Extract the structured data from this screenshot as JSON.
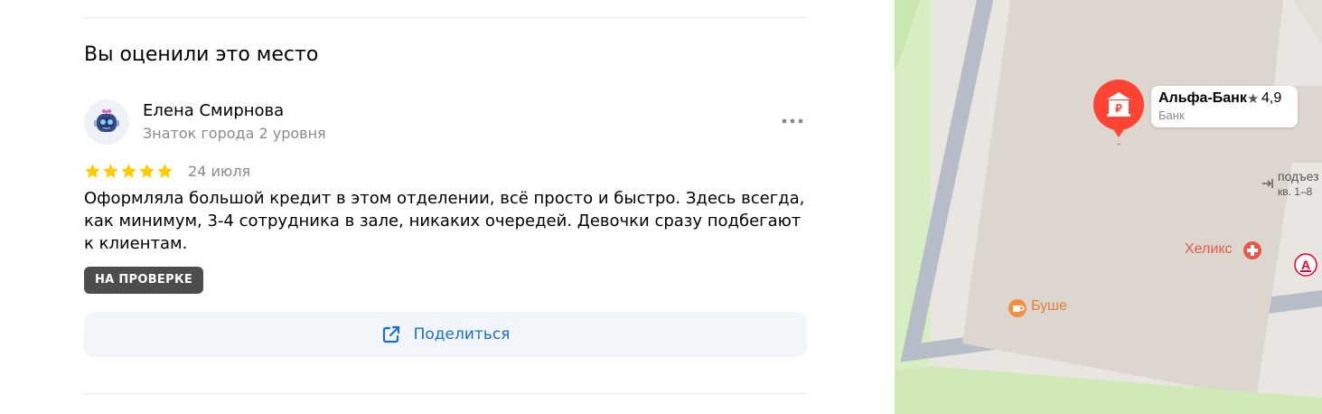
{
  "review": {
    "section_title": "Вы оценили это место",
    "author": {
      "name": "Елена Смирнова",
      "level": "Знаток города 2 уровня"
    },
    "rating": 5,
    "date": "24 июля",
    "text": "Оформляла большой кредит в этом отделении, всё просто и быстро. Здесь всегда, как минимум, 3-4 сотрудника в зале, никаких очередей. Девочки сразу подбегают к клиентам.",
    "status_badge": "НА ПРОВЕРКЕ",
    "share_label": "Поделиться"
  },
  "map": {
    "place": {
      "name": "Альфа-Банк",
      "rating": "4,9",
      "category": "Банк"
    },
    "pois": {
      "helix": "Хеликс",
      "bushe": "Буше",
      "entrance": "подъез",
      "apartments": "кв. 1–8"
    }
  },
  "colors": {
    "accent_blue": "#1a6fd9",
    "star_yellow": "#fc0",
    "badge_bg": "#4d4d4d",
    "pin_red": "#f43",
    "helix_red": "#e8574a",
    "bushe_orange": "#f09040"
  }
}
